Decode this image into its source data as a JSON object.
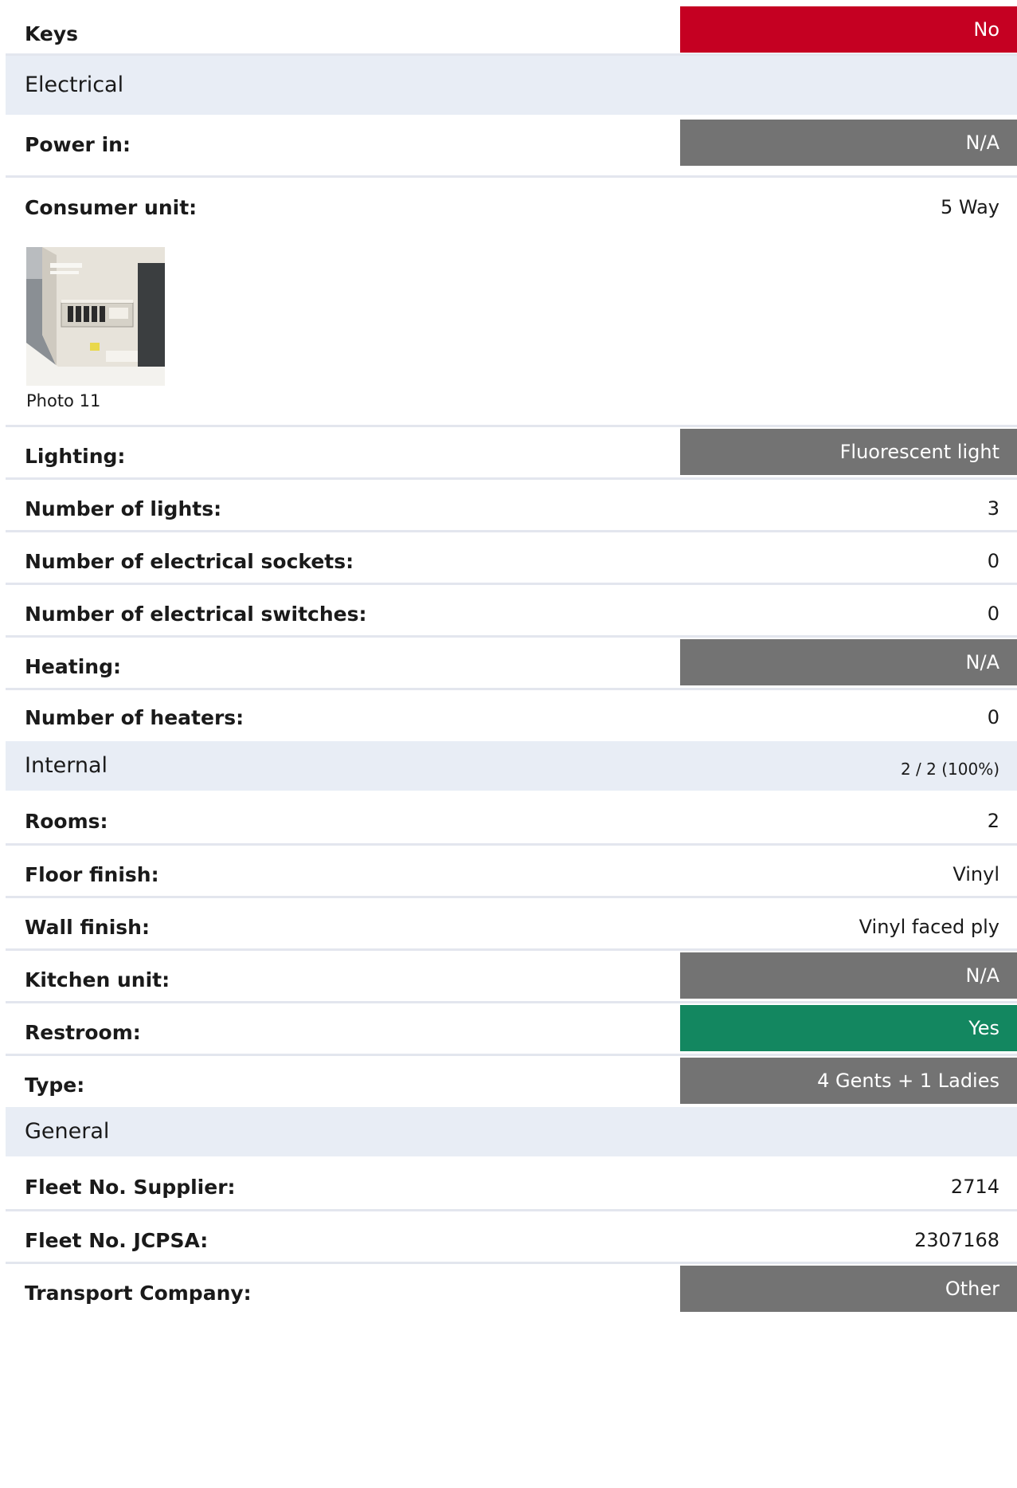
{
  "keys": {
    "label": "Keys",
    "value": "No"
  },
  "sections": {
    "electrical": {
      "title": "Electrical",
      "power_in": {
        "label": "Power in:",
        "value": "N/A"
      },
      "consumer_unit": {
        "label": "Consumer unit:",
        "value": "5 Way",
        "photo_caption": "Photo 11"
      },
      "lighting": {
        "label": "Lighting:",
        "value": "Fluorescent light"
      },
      "number_of_lights": {
        "label": "Number of lights:",
        "value": "3"
      },
      "number_of_sockets": {
        "label": "Number of electrical sockets:",
        "value": "0"
      },
      "number_of_switches": {
        "label": "Number of electrical switches:",
        "value": "0"
      },
      "heating": {
        "label": "Heating:",
        "value": "N/A"
      },
      "number_of_heaters": {
        "label": "Number of heaters:",
        "value": "0"
      }
    },
    "internal": {
      "title": "Internal",
      "progress": "2 / 2 (100%)",
      "rooms": {
        "label": "Rooms:",
        "value": "2"
      },
      "floor_finish": {
        "label": "Floor finish:",
        "value": "Vinyl"
      },
      "wall_finish": {
        "label": "Wall finish:",
        "value": "Vinyl faced ply"
      },
      "kitchen_unit": {
        "label": "Kitchen unit:",
        "value": "N/A"
      },
      "restroom": {
        "label": "Restroom:",
        "value": "Yes"
      },
      "type": {
        "label": "Type:",
        "value": "4 Gents + 1 Ladies"
      }
    },
    "general": {
      "title": "General",
      "fleet_no_supplier": {
        "label": "Fleet No. Supplier:",
        "value": "2714"
      },
      "fleet_no_jcpsa": {
        "label": "Fleet No. JCPSA:",
        "value": "2307168"
      },
      "transport_company": {
        "label": "Transport Company:",
        "value": "Other"
      }
    }
  },
  "colors": {
    "negative": "#c50022",
    "neutral": "#737373",
    "positive": "#138760",
    "section_bg": "#e8edf5",
    "divider": "#e3e6ee"
  }
}
